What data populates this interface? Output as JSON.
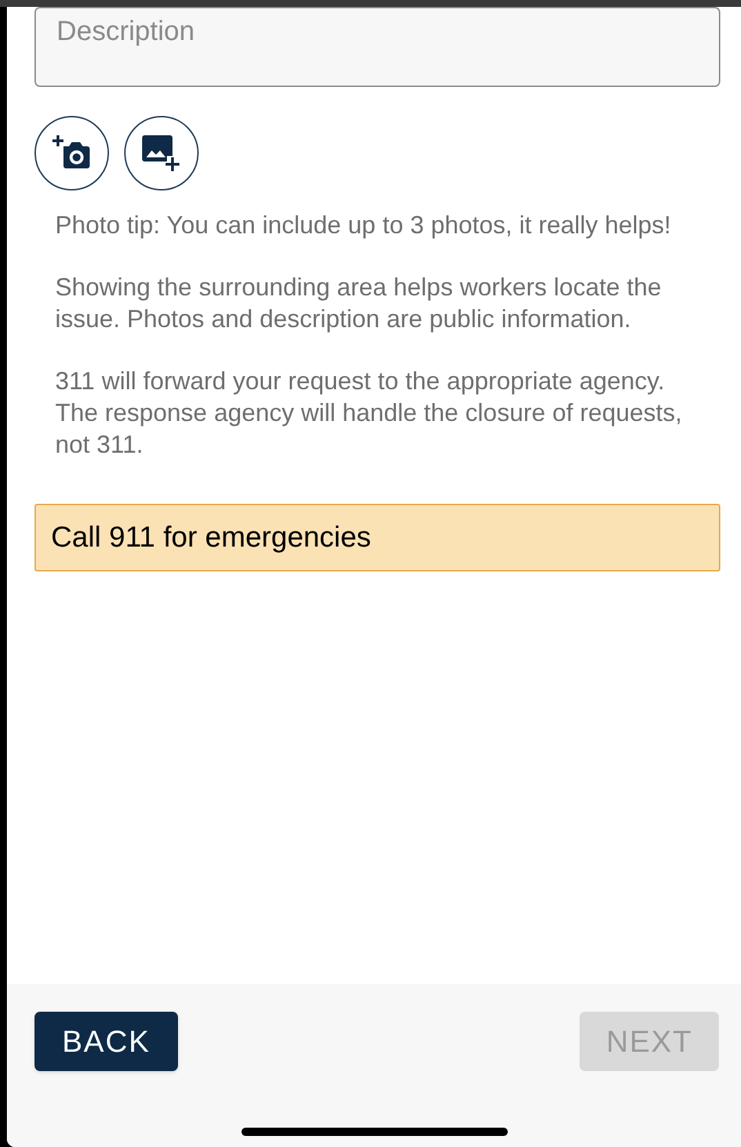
{
  "description_field": {
    "placeholder": "Description"
  },
  "photo_buttons": [
    {
      "kind": "camera"
    },
    {
      "kind": "gallery"
    }
  ],
  "paragraphs": [
    "Photo tip: You can include up to 3 photos, it really helps!",
    "Showing the surrounding area helps workers locate the issue. Photos and description are public information.",
    "311 will forward your request to the appropriate agency. The response agency will handle the closure of requests, not 311."
  ],
  "notice": "Call 911 for emergencies",
  "buttons": [
    {
      "label": "BACK",
      "disabled": false
    },
    {
      "label": "NEXT",
      "disabled": true
    }
  ]
}
